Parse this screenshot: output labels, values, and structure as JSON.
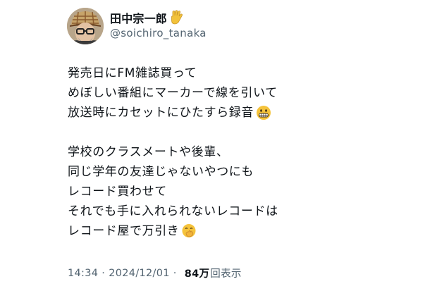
{
  "author": {
    "display_name": "田中宗一郎",
    "handle": "@soichiro_tanaka",
    "name_emoji": "vulcan-salute-hand-icon"
  },
  "tweet": {
    "lines_block_1": [
      "発売日にFM雑誌買って",
      "めぼしい番組にマーカーで線を引いて",
      "放送時にカセットにひたすら録音"
    ],
    "lines_block_2": [
      "学校のクラスメートや後輩、",
      "同じ学年の友達じゃないやつにも",
      "レコード買わせて",
      "それでも手に入れられないレコードは",
      "レコード屋で万引き"
    ],
    "emojis": {
      "line_3": "grimacing-face-icon",
      "last_line": "face-with-hand-over-mouth-icon"
    }
  },
  "meta": {
    "time": "14:34",
    "separator": "·",
    "date": "2024/12/01",
    "view_count": "84万",
    "view_label": "回表示"
  }
}
